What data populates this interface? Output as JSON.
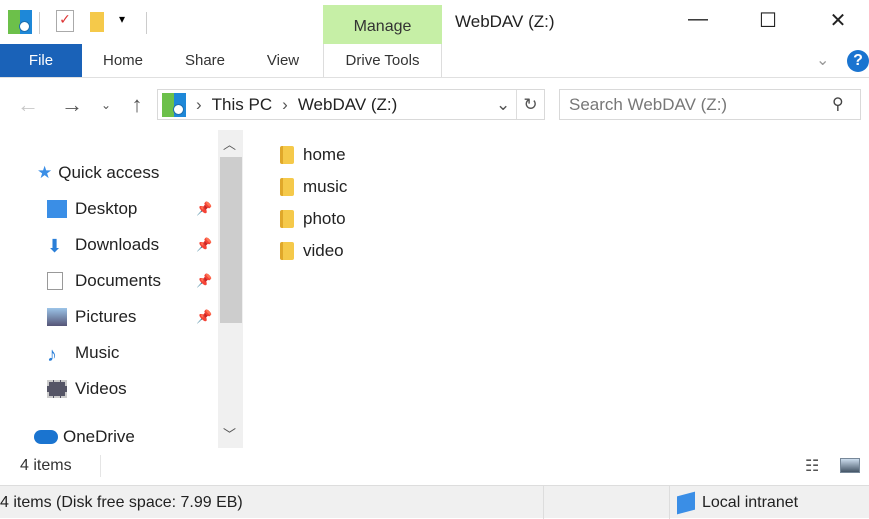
{
  "window": {
    "title": "WebDAV (Z:)",
    "minimize": "—",
    "maximize": "☐",
    "close": "✕"
  },
  "ribbon": {
    "context_group": "Manage",
    "tabs": [
      {
        "label": "File"
      },
      {
        "label": "Home"
      },
      {
        "label": "Share"
      },
      {
        "label": "View"
      },
      {
        "label": "Drive Tools"
      }
    ]
  },
  "address": {
    "crumbs": [
      "This PC",
      "WebDAV (Z:)"
    ],
    "sep": "›"
  },
  "search": {
    "placeholder": "Search WebDAV (Z:)"
  },
  "sidebar": {
    "items": [
      {
        "label": "Quick access",
        "icon": "star-icon"
      },
      {
        "label": "Desktop",
        "icon": "desktop-icon",
        "pinned": true
      },
      {
        "label": "Downloads",
        "icon": "download-icon",
        "pinned": true
      },
      {
        "label": "Documents",
        "icon": "documents-icon",
        "pinned": true
      },
      {
        "label": "Pictures",
        "icon": "pictures-icon",
        "pinned": true
      },
      {
        "label": "Music",
        "icon": "music-icon"
      },
      {
        "label": "Videos",
        "icon": "videos-icon"
      },
      {
        "label": "OneDrive",
        "icon": "cloud-icon"
      }
    ]
  },
  "files": [
    {
      "name": "home"
    },
    {
      "name": "music"
    },
    {
      "name": "photo"
    },
    {
      "name": "video"
    }
  ],
  "item_count": "4 items",
  "status": {
    "text": "4 items (Disk free space: 7.99 EB)",
    "zone": "Local intranet"
  },
  "colors": {
    "file_tab": "#1a62b8",
    "manage": "#c6efa6"
  }
}
